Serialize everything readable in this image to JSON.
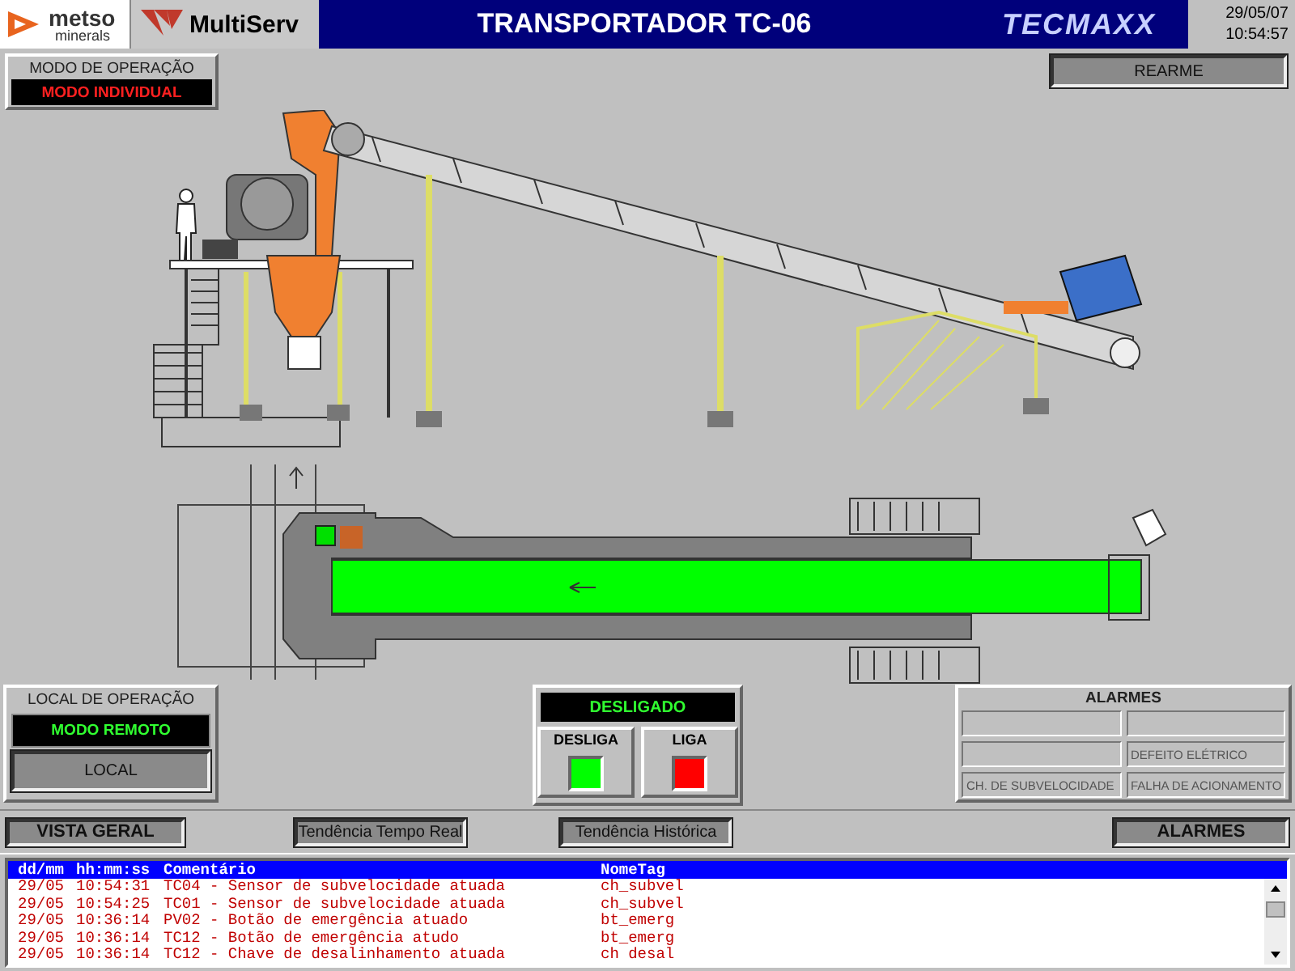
{
  "header": {
    "brand_left": {
      "name": "metso",
      "sub": "minerals"
    },
    "brand_middle": "MultiServ",
    "title": "TRANSPORTADOR TC-06",
    "brand_right": "TECMAXX",
    "date": "29/05/07",
    "time": "10:54:57"
  },
  "operation_mode": {
    "label": "MODO DE OPERAÇÃO",
    "value": "MODO INDIVIDUAL"
  },
  "reset_button": "REARME",
  "operation_location": {
    "label": "LOCAL DE OPERAÇÃO",
    "value": "MODO REMOTO",
    "button": "LOCAL"
  },
  "status": {
    "value": "DESLIGADO",
    "buttons": [
      {
        "label": "DESLIGA",
        "kind": "off"
      },
      {
        "label": "LIGA",
        "kind": "on"
      }
    ]
  },
  "alarms_panel": {
    "title": "ALARMES",
    "cells": [
      {
        "active": false
      },
      {
        "active": false
      },
      {
        "active": false
      },
      {
        "label": "DEFEITO ELÉTRICO",
        "active": false
      },
      {
        "label": "CH. DE SUBVELOCIDADE",
        "active": false
      },
      {
        "label": "FALHA DE ACIONAMENTO",
        "active": false
      }
    ]
  },
  "nav_buttons": [
    "VISTA GERAL",
    "Tendência Tempo Real",
    "Tendência Histórica",
    "ALARMES"
  ],
  "alarm_list": {
    "columns": [
      "dd/mm",
      "hh:mm:ss",
      "Comentário",
      "NomeTag"
    ],
    "rows": [
      {
        "date": "29/05",
        "time": "10:54:31",
        "comment": "TC04 - Sensor de subvelocidade atuada",
        "tag": "ch_subvel"
      },
      {
        "date": "29/05",
        "time": "10:54:25",
        "comment": "TC01 - Sensor de subvelocidade atuada",
        "tag": "ch_subvel"
      },
      {
        "date": "29/05",
        "time": "10:36:14",
        "comment": "PV02 - Botão de emergência  atuado",
        "tag": "bt_emerg"
      },
      {
        "date": "29/05",
        "time": "10:36:14",
        "comment": "TC12 - Botão de emergência  atudo",
        "tag": "bt_emerg"
      },
      {
        "date": "29/05",
        "time": "10:36:14",
        "comment": "TC12 - Chave de desalinhamento atuada",
        "tag": "ch desal"
      }
    ]
  }
}
